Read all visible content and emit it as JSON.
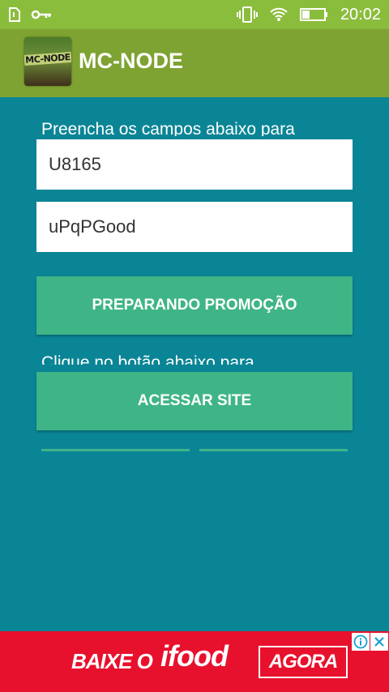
{
  "status_bar": {
    "time": "20:02",
    "icons": [
      "sim-card-icon",
      "key-icon",
      "vibrate-icon",
      "wifi-icon",
      "battery-icon"
    ]
  },
  "app_bar": {
    "title": "MC-NODE",
    "logo_text": "MC-NODE"
  },
  "form": {
    "instruction_text": "Preencha os campos abaixo para",
    "field_1_value": "U8165",
    "field_2_value": "uPqPGood",
    "primary_button_label": "PREPARANDO PROMOÇÃO",
    "secondary_instruction_text": "Clique no botão abaixo para",
    "access_button_label": "ACESSAR SITE"
  },
  "ad_banner": {
    "text_left": "BAIXE O",
    "brand": "ifood",
    "cta": "AGORA",
    "info_icon": "info-icon",
    "close_icon": "close-icon"
  },
  "colors": {
    "status_bar": "#8bbd3d",
    "app_bar": "#7ea332",
    "background": "#0a8596",
    "button": "#3fb587",
    "ad": "#e8112d"
  }
}
